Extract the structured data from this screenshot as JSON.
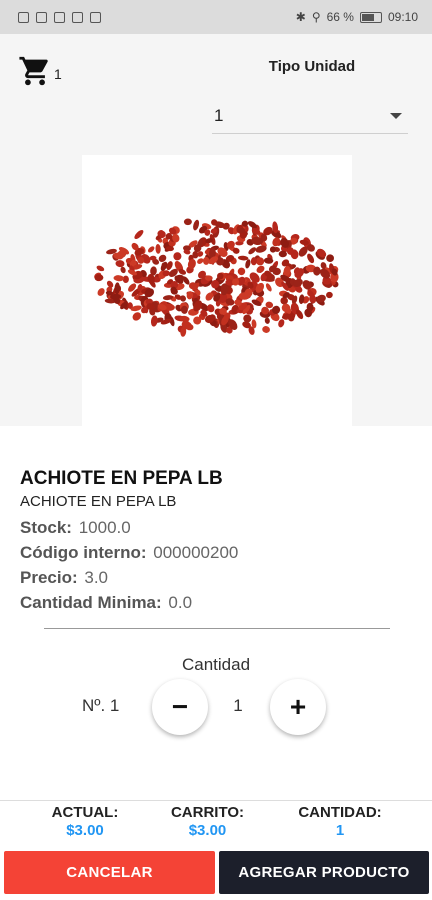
{
  "status_bar": {
    "battery": "66 %",
    "time": "09:10"
  },
  "header": {
    "cart_count": "1",
    "unit_type_label": "Tipo Unidad",
    "unit_value": "1"
  },
  "product": {
    "name": "ACHIOTE EN PEPA LB",
    "description": "ACHIOTE EN PEPA LB",
    "stock_label": "Stock:",
    "stock_value": "1000.0",
    "code_label": "Código interno:",
    "code_value": "000000200",
    "price_label": "Precio:",
    "price_value": "3.0",
    "min_qty_label": "Cantidad Minima:",
    "min_qty_value": "0.0"
  },
  "quantity": {
    "label": "Cantidad",
    "number_label": "Nº. 1",
    "value": "1",
    "minus": "−",
    "plus": "+"
  },
  "summary": {
    "actual_label": "ACTUAL:",
    "actual_value": "$3.00",
    "cart_label": "CARRITO:",
    "cart_value": "$3.00",
    "qty_label": "CANTIDAD:",
    "qty_value": "1"
  },
  "buttons": {
    "cancel": "CANCELAR",
    "add": "AGREGAR PRODUCTO"
  },
  "colors": {
    "accent_blue": "#2196f3",
    "cancel_red": "#f44336",
    "add_dark": "#1c1f2b"
  }
}
